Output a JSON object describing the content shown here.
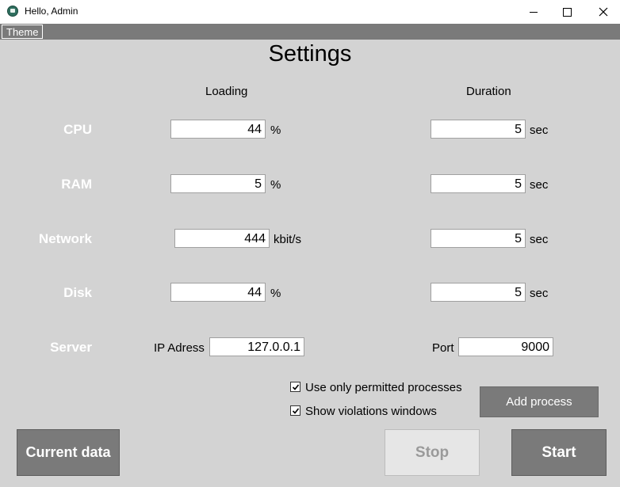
{
  "window": {
    "title": "Hello, Admin"
  },
  "menu": {
    "theme": "Theme"
  },
  "page": {
    "title": "Settings"
  },
  "columns": {
    "loading": "Loading",
    "duration": "Duration"
  },
  "rows": {
    "cpu": {
      "label": "CPU",
      "loading": "44",
      "loading_unit": "%",
      "duration": "5",
      "duration_unit": "sec"
    },
    "ram": {
      "label": "RAM",
      "loading": "5",
      "loading_unit": "%",
      "duration": "5",
      "duration_unit": "sec"
    },
    "network": {
      "label": "Network",
      "loading": "444",
      "loading_unit": "kbit/s",
      "duration": "5",
      "duration_unit": "sec"
    },
    "disk": {
      "label": "Disk",
      "loading": "44",
      "loading_unit": "%",
      "duration": "5",
      "duration_unit": "sec"
    }
  },
  "server": {
    "label": "Server",
    "ip_label": "IP Adress",
    "ip_value": "127.0.0.1",
    "port_label": "Port",
    "port_value": "9000"
  },
  "options": {
    "permitted_processes": {
      "label": "Use only permitted processes",
      "checked": true
    },
    "violation_windows": {
      "label": "Show violations windows",
      "checked": true
    }
  },
  "buttons": {
    "add_process": "Add process",
    "current_data": "Current data",
    "stop": "Stop",
    "start": "Start"
  },
  "colors": {
    "background": "#d3d3d3",
    "button": "#7a7a7a",
    "button_disabled": "#e6e6e6",
    "label": "#ffffff"
  }
}
